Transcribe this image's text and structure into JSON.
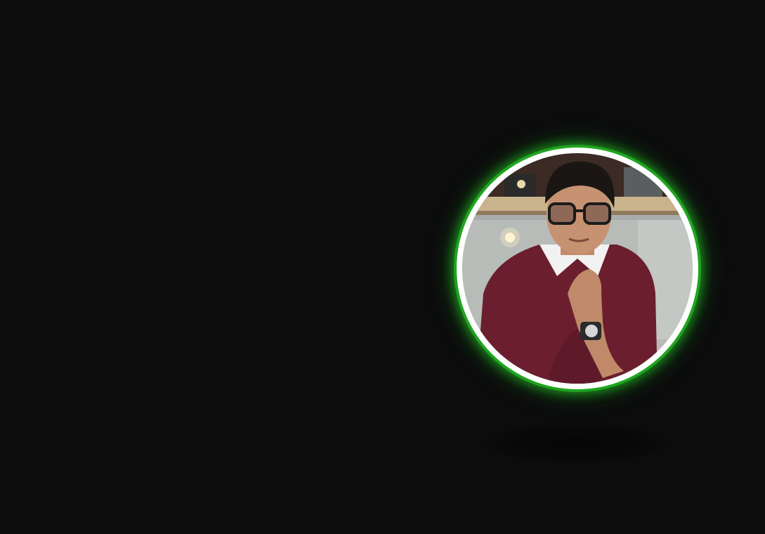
{
  "profile": {
    "avatar_icon": "avatar-photo-icon",
    "ring_color": "#ffffff",
    "glow_color": "#1fa51f",
    "background_color": "#0c0c0d"
  }
}
